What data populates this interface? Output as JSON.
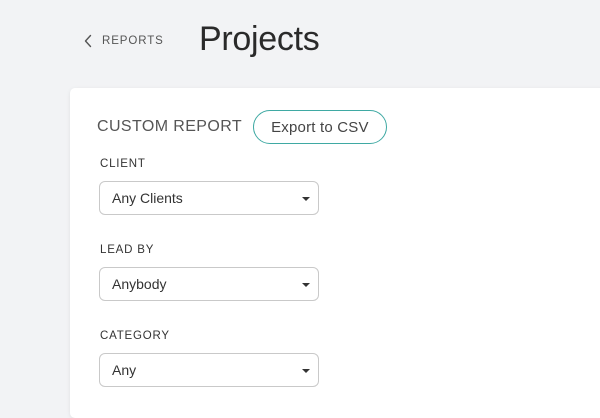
{
  "header": {
    "back_label": "REPORTS",
    "title": "Projects"
  },
  "report": {
    "title": "CUSTOM REPORT",
    "export_label": "Export to CSV"
  },
  "filters": [
    {
      "label": "CLIENT",
      "value": "Any Clients"
    },
    {
      "label": "LEAD BY",
      "value": "Anybody"
    },
    {
      "label": "CATEGORY",
      "value": "Any"
    }
  ],
  "colors": {
    "accent": "#3fa9a3",
    "background": "#f2f3f5",
    "card": "#ffffff"
  },
  "icons": {
    "back": "chevron-left-icon",
    "dropdown": "caret-down-icon"
  }
}
